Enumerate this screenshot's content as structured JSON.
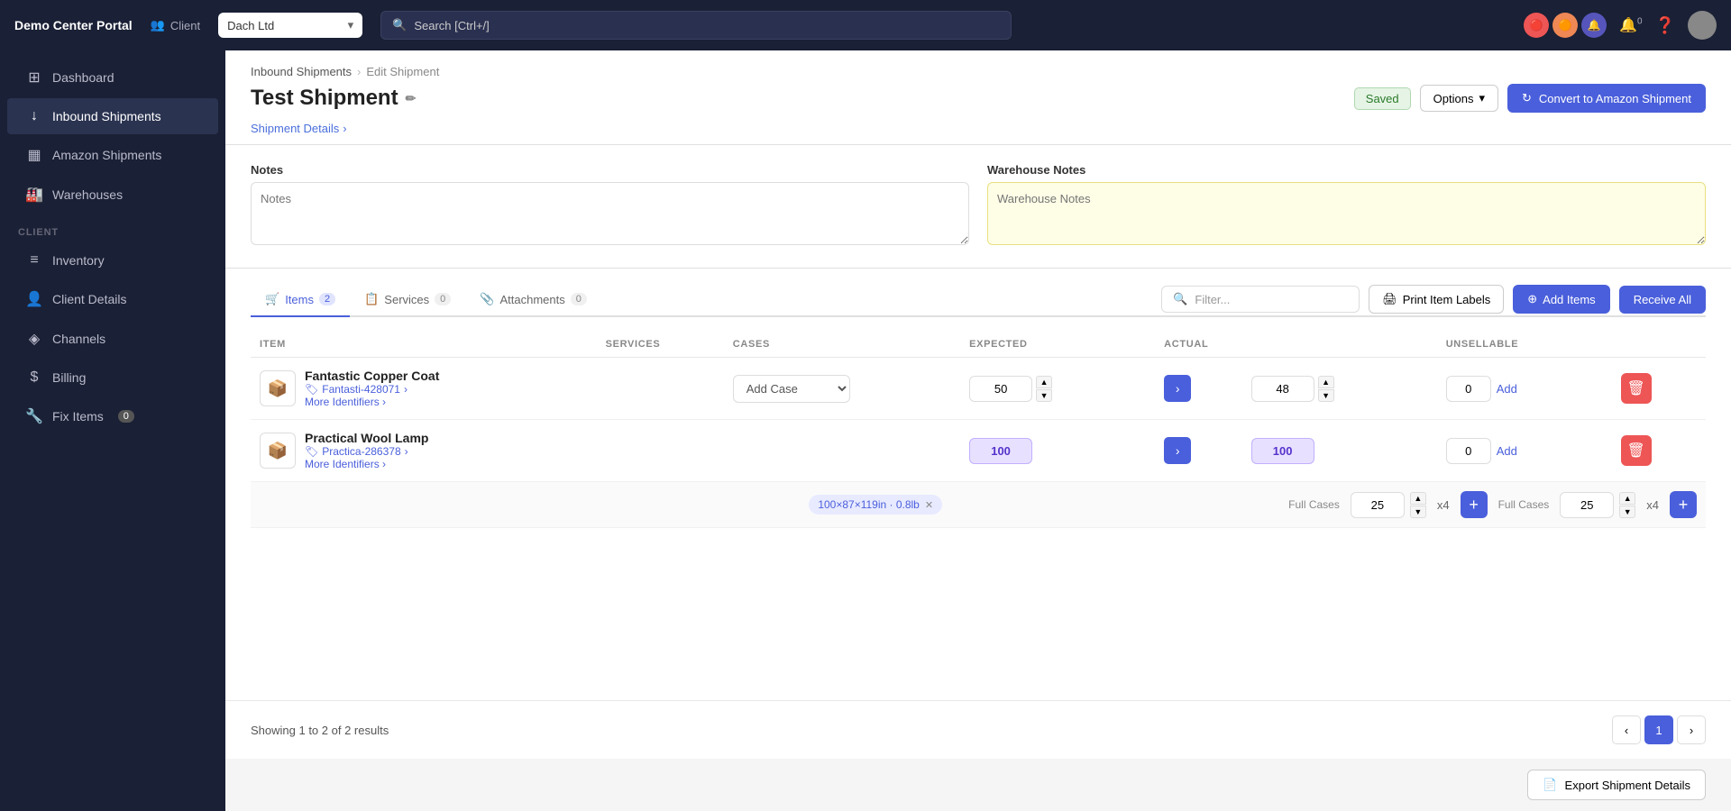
{
  "app": {
    "brand": "Demo Center Portal",
    "client_label": "Client",
    "client_name": "Dach Ltd",
    "search_placeholder": "Search [Ctrl+/]"
  },
  "sidebar": {
    "items": [
      {
        "id": "dashboard",
        "label": "Dashboard",
        "icon": "⊞",
        "active": false
      },
      {
        "id": "inbound-shipments",
        "label": "Inbound Shipments",
        "icon": "↓",
        "active": true
      },
      {
        "id": "amazon-shipments",
        "label": "Amazon Shipments",
        "icon": "▦",
        "active": false
      },
      {
        "id": "warehouses",
        "label": "Warehouses",
        "icon": "🏭",
        "active": false
      }
    ],
    "client_section": "CLIENT",
    "client_items": [
      {
        "id": "inventory",
        "label": "Inventory",
        "icon": "≡",
        "active": false
      },
      {
        "id": "client-details",
        "label": "Client Details",
        "icon": "👤",
        "active": false
      },
      {
        "id": "channels",
        "label": "Channels",
        "icon": "◈",
        "active": false
      },
      {
        "id": "billing",
        "label": "Billing",
        "icon": "$",
        "active": false
      },
      {
        "id": "fix-items",
        "label": "Fix Items",
        "icon": "🔧",
        "badge": "0",
        "active": false
      }
    ]
  },
  "breadcrumb": {
    "items": [
      "Inbound Shipments",
      "Edit Shipment"
    ]
  },
  "page": {
    "title": "Test Shipment",
    "status": "Saved",
    "sub_link": "Shipment Details",
    "options_label": "Options",
    "convert_label": "Convert to Amazon Shipment"
  },
  "notes": {
    "notes_label": "Notes",
    "notes_placeholder": "Notes",
    "warehouse_label": "Warehouse Notes",
    "warehouse_placeholder": "Warehouse Notes"
  },
  "tabs": [
    {
      "id": "items",
      "label": "Items",
      "badge": "2",
      "active": true
    },
    {
      "id": "services",
      "label": "Services",
      "badge": "0",
      "active": false
    },
    {
      "id": "attachments",
      "label": "Attachments",
      "badge": "0",
      "active": false
    }
  ],
  "toolbar": {
    "filter_placeholder": "Filter...",
    "print_label": "Print Item Labels",
    "add_items_label": "Add Items",
    "receive_all_label": "Receive All"
  },
  "table": {
    "columns": [
      "ITEM",
      "SERVICES",
      "CASES",
      "EXPECTED",
      "ACTUAL",
      "UNSELLABLE"
    ],
    "rows": [
      {
        "id": "row-1",
        "name": "Fantastic Copper Coat",
        "sku": "Fantasti-428071",
        "case_placeholder": "Add Case",
        "expected": "50",
        "actual": "48",
        "unsellable": "0",
        "has_case_row": false
      },
      {
        "id": "row-2",
        "name": "Practical Wool Lamp",
        "sku": "Practica-286378",
        "case_placeholder": "",
        "expected": "100",
        "actual": "100",
        "unsellable": "0",
        "has_case_row": true
      }
    ],
    "case_row": {
      "tag_label": "100×87×119in · 0.8lb",
      "full_cases_label_1": "Full Cases",
      "full_cases_value_1": "25",
      "x4_label": "x4",
      "full_cases_label_2": "Full Cases",
      "full_cases_value_2": "25",
      "x4_label_2": "x4"
    }
  },
  "pagination": {
    "info": "Showing 1 to 2 of 2 results",
    "current_page": "1"
  },
  "export": {
    "label": "Export Shipment Details"
  }
}
